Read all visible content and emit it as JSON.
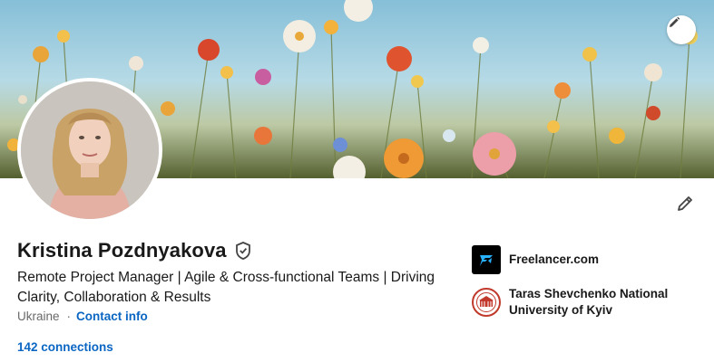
{
  "profile": {
    "name": "Kristina Pozdnyakova",
    "headline": "Remote Project Manager | Agile & Cross-functional Teams | Driving Clarity, Collaboration & Results",
    "location": "Ukraine",
    "separator": "·",
    "contact_label": "Contact info",
    "connections_label": "142 connections"
  },
  "experience": {
    "company": "Freelancer.com",
    "company_logo_color": "#000000"
  },
  "education": {
    "school_line1": "Taras Shevchenko National",
    "school_line2": "University of Kyiv",
    "logo_color": "#c0392b"
  },
  "icons": {
    "banner_edit": "pencil-icon",
    "profile_edit": "pencil-icon",
    "verified": "verified-shield-icon"
  },
  "colors": {
    "link": "#0a66c2",
    "text_primary": "#000000e6",
    "text_secondary": "#00000099"
  }
}
